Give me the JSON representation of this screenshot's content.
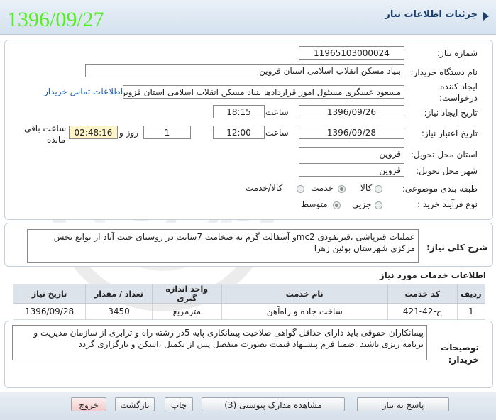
{
  "header": {
    "title": "جزئیات اطلاعات نیاز",
    "date_stamp": "1396/09/27"
  },
  "form": {
    "need_number_label": "شماره نیاز:",
    "need_number": "1196510300002‪4",
    "buyer_org_label": "نام دستگاه خریدار:",
    "buyer_org": "بنیاد مسکن انقلاب اسلامی استان قزوین",
    "creator_label_1": "ایجاد کننده",
    "creator_label_2": "درخواست:",
    "creator": "مسعود عسگری مسئول امور قراردادها بنیاد مسکن انقلاب اسلامی استان قزوین",
    "contact_link": "اطلاعات تماس خریدار",
    "created_date_label": "تاریخ ایجاد نیاز:",
    "created_date": "1396/09/26",
    "time_label": "ساعت",
    "created_time": "18:15",
    "validity_label": "تاریخ اعتبار نیاز:",
    "validity_date": "1396/09/28",
    "validity_time": "12:00",
    "days_value": "1",
    "days_label": "روز و",
    "remaining_time": "02:48:16",
    "remaining_label_1": "ساعت باقی",
    "remaining_label_2": "مانده",
    "province_label": "استان محل تحویل:",
    "province": "قزوین",
    "city_label": "شهر محل تحویل:",
    "city": "قزوین",
    "category_label": "طبقه بندی موضوعی:",
    "category_options": [
      "کالا",
      "خدمت",
      "کالا/خدمت"
    ],
    "category_selected": "خدمت",
    "process_label": "نوع فرآیند خرید :",
    "process_options": [
      "جزیی",
      "متوسط"
    ],
    "process_selected": "متوسط"
  },
  "description": {
    "label": "شرح کلی نیاز:",
    "text": "عملیات قیرپاشی ،قیرنفوذی mc2و آسفالت گرم به ضخامت 7سانت در روستای جنت آباد از توابع بخش مرکزی شهرستان بوئین زهرا"
  },
  "services": {
    "section_title": "اطلاعات خدمات مورد نیاز",
    "columns": [
      "ردیف",
      "کد خدمت",
      "نام خدمت",
      "واحد اندازه گیری",
      "تعداد / مقدار",
      "تاریخ نیاز"
    ],
    "rows": [
      {
        "row": "1",
        "code": "ج-42-421",
        "name": "ساخت جاده و راه‌آهن",
        "unit": "مترمربع",
        "qty": "3450",
        "date": "1396/09/28"
      }
    ]
  },
  "buyer_notes": {
    "label_1": "توضیحات",
    "label_2": "خریدار:",
    "text": "پیمانکاران حقوقی باید دارای حداقل گواهی صلاحیت پیمانکاری پایه 5در رشته راه و ترابری از سازمان مدیریت و برنامه ریزی باشند .ضمنا فرم پیشنهاد قیمت بصورت منفصل پس از تکمیل ،اسکن و بارگزاری گردد"
  },
  "buttons": {
    "respond": "پاسخ به نیاز",
    "view_docs": "مشاهده مدارک پیوستی (3)",
    "print": "چاپ",
    "back": "بازگشت",
    "exit": "خروج"
  },
  "colors": {
    "header_text": "#1c3f6b",
    "date_stamp": "#55ee22",
    "link": "#1f5fb4",
    "remaining_bg": "#fdf5c9"
  }
}
